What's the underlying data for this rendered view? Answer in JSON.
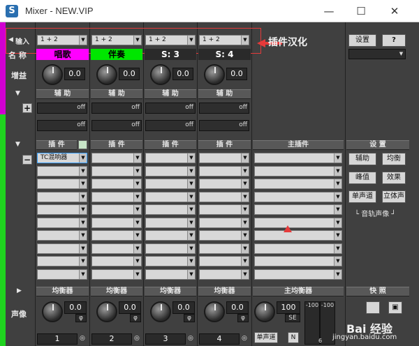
{
  "window": {
    "title": "Mixer - NEW.VIP",
    "app_icon": "S",
    "min_glyph": "—",
    "max_glyph": "☐",
    "close_glyph": "✕"
  },
  "labels": {
    "input": "输入",
    "name": "名 称",
    "gain": "增益",
    "pan": "声像",
    "plugin_translate": "插件汉化"
  },
  "channels": [
    {
      "input": "1 + 2",
      "name": "唱歌",
      "name_bg": "#ff00ff",
      "name_color": "#000000",
      "gain": "0.0",
      "aux_hdr": "辅 助",
      "plugins_hdr": "插 件",
      "eq_hdr": "均衡器",
      "pan_val": "0.0",
      "num": "1"
    },
    {
      "input": "1 + 2",
      "name": "伴奏",
      "name_bg": "#00e600",
      "name_color": "#000000",
      "gain": "0.0",
      "aux_hdr": "辅 助",
      "plugins_hdr": "插 件",
      "eq_hdr": "均衡器",
      "pan_val": "0.0",
      "num": "2"
    },
    {
      "input": "1 + 2",
      "name": "S: 3",
      "name_bg": "#2a2a2a",
      "name_color": "#ffffff",
      "gain": "0.0",
      "aux_hdr": "辅 助",
      "plugins_hdr": "插 件",
      "eq_hdr": "均衡器",
      "pan_val": "0.0",
      "num": "3"
    },
    {
      "input": "1 + 2",
      "name": "S: 4",
      "name_bg": "#2a2a2a",
      "name_color": "#ffffff",
      "gain": "0.0",
      "aux_hdr": "辅 助",
      "plugins_hdr": "插 件",
      "eq_hdr": "均衡器",
      "pan_val": "0.0",
      "num": "4"
    }
  ],
  "send_off": "off",
  "first_plugin": "TC混响器",
  "master": {
    "plugins_hdr": "主插件",
    "eq_hdr": "主均衡器",
    "pan_val": "100",
    "se": "SE",
    "meter_l": "-100",
    "meter_r": "-100",
    "mono_btn": "单声道",
    "n_btn": "N",
    "scale_6": "6"
  },
  "right_panel": {
    "settings": "设置",
    "help": "?",
    "settings_hdr": "设 置",
    "aux": "辅助",
    "eq": "均衡",
    "peak": "峰值",
    "effects": "效果",
    "mono": "单声道",
    "stereo": "立体声",
    "track_pan": "音轨声像",
    "snapshot_hdr": "快 照"
  },
  "watermark": {
    "brand": "Bai 经验",
    "url": "jingyan.baidu.com"
  }
}
